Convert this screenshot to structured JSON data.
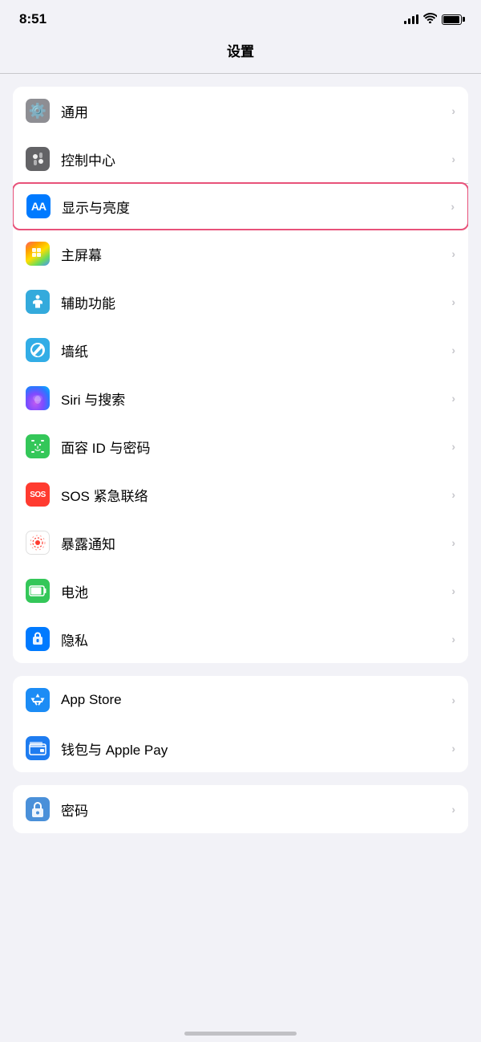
{
  "statusBar": {
    "time": "8:51",
    "signal": "signal",
    "wifi": "wifi",
    "battery": "battery"
  },
  "pageTitle": "设置",
  "settingsGroups": [
    {
      "id": "group1",
      "items": [
        {
          "id": "general",
          "label": "通用",
          "iconType": "gear",
          "iconColor": "gray",
          "highlighted": false
        },
        {
          "id": "control-center",
          "label": "控制中心",
          "iconType": "toggle",
          "iconColor": "gray2",
          "highlighted": false
        },
        {
          "id": "display",
          "label": "显示与亮度",
          "iconType": "aa",
          "iconColor": "blue",
          "highlighted": true
        },
        {
          "id": "home-screen",
          "label": "主屏幕",
          "iconType": "grid",
          "iconColor": "colorful",
          "highlighted": false
        },
        {
          "id": "accessibility",
          "label": "辅助功能",
          "iconType": "accessibility",
          "iconColor": "blue2",
          "highlighted": false
        },
        {
          "id": "wallpaper",
          "label": "墙纸",
          "iconType": "flower",
          "iconColor": "teal",
          "highlighted": false
        },
        {
          "id": "siri",
          "label": "Siri 与搜索",
          "iconType": "siri",
          "iconColor": "siri",
          "highlighted": false
        },
        {
          "id": "faceid",
          "label": "面容 ID 与密码",
          "iconType": "faceid",
          "iconColor": "green",
          "highlighted": false
        },
        {
          "id": "sos",
          "label": "SOS 紧急联络",
          "iconType": "sos",
          "iconColor": "red",
          "highlighted": false
        },
        {
          "id": "exposure",
          "label": "暴露通知",
          "iconType": "exposure",
          "iconColor": "pink",
          "highlighted": false
        },
        {
          "id": "battery",
          "label": "电池",
          "iconType": "battery",
          "iconColor": "green",
          "highlighted": false
        },
        {
          "id": "privacy",
          "label": "隐私",
          "iconType": "privacy",
          "iconColor": "blue3",
          "highlighted": false
        }
      ]
    },
    {
      "id": "group2",
      "items": [
        {
          "id": "appstore",
          "label": "App Store",
          "iconType": "appstore",
          "iconColor": "appstore",
          "highlighted": false
        },
        {
          "id": "wallet",
          "label": "钱包与 Apple Pay",
          "iconType": "wallet",
          "iconColor": "wallet",
          "highlighted": false
        }
      ]
    },
    {
      "id": "group3",
      "items": [
        {
          "id": "password",
          "label": "密码",
          "iconType": "lock",
          "iconColor": "password",
          "highlighted": false
        }
      ]
    }
  ]
}
